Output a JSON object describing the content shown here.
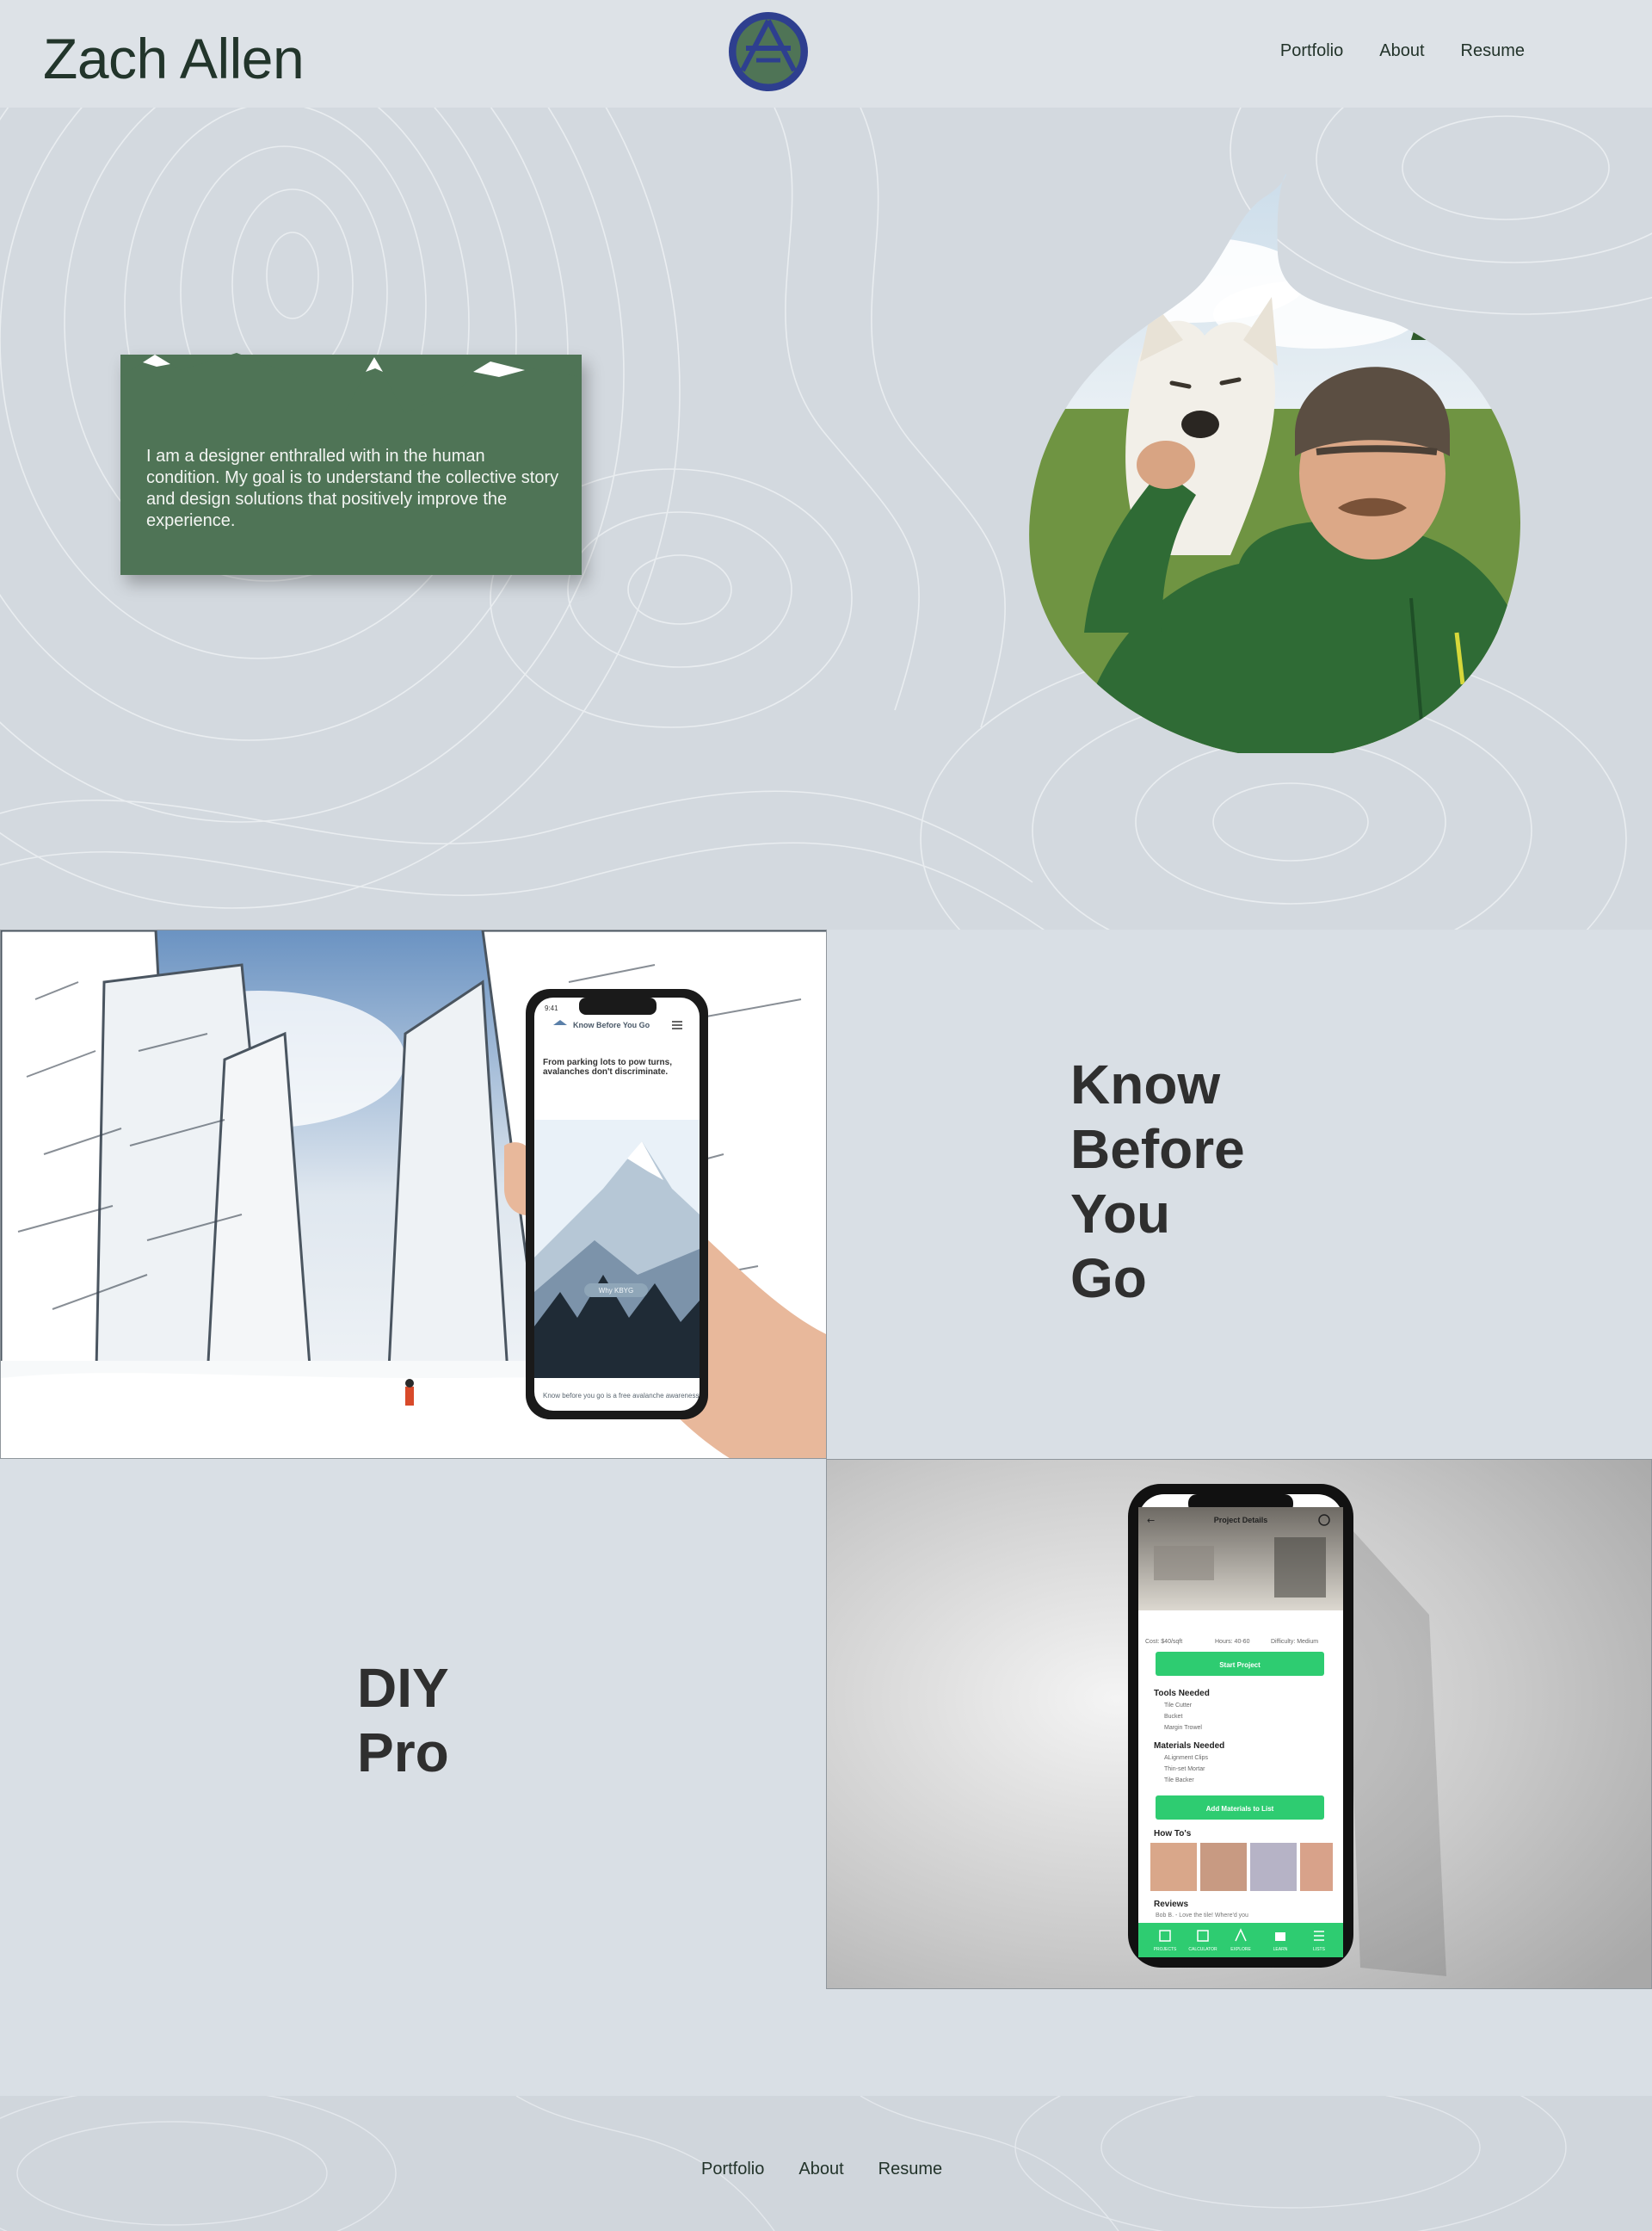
{
  "header": {
    "site_title": "Zach Allen",
    "logo_icon": "mountain-monogram-icon",
    "nav": [
      {
        "label": "Portfolio"
      },
      {
        "label": "About"
      },
      {
        "label": "Resume"
      }
    ]
  },
  "hero": {
    "bio": "I am a designer enthralled with in the human condition. My goal is to understand the collective story and design solutions that positively improve the experience.",
    "portrait_icon": "portrait-photo-with-dog"
  },
  "projects": [
    {
      "title": "Know\nBefore\nYou\nGo",
      "phone": {
        "time": "9:41",
        "app_name": "Know Before You Go",
        "headline": "From parking lots to pow turns, avalanches don't discriminate.",
        "button": "Why KBYG",
        "footer_text": "Know before you go is a free avalanche awareness"
      }
    },
    {
      "title": "DIY\nPro",
      "phone": {
        "screen_title": "Project Details",
        "meta_cost": "Cost: $40/sqft",
        "meta_hours": "Hours: 40-60",
        "meta_difficulty": "Difficulty: Medium",
        "start_button": "Start Project",
        "tools_heading": "Tools Needed",
        "tools": [
          "Tile Cutter",
          "Bucket",
          "Margin Trowel"
        ],
        "materials_heading": "Materials Needed",
        "materials": [
          "ALignment Clips",
          "Thin-set Mortar",
          "Tile Backer"
        ],
        "add_button": "Add Materials to List",
        "howto_heading": "How To's",
        "reviews_heading": "Reviews",
        "review_snippet": "Bob B. - Love the tile! Where'd you",
        "tabs": [
          "PROJECTS",
          "CALCULATOR",
          "EXPLORE",
          "LEARN",
          "LISTS"
        ]
      }
    }
  ],
  "footer": {
    "nav": [
      {
        "label": "Portfolio"
      },
      {
        "label": "About"
      },
      {
        "label": "Resume"
      }
    ]
  },
  "colors": {
    "page_bg": "#d9dfe5",
    "brand_green": "#4f7456",
    "logo_blue": "#2e3f8f",
    "accent_green": "#2ecc71"
  }
}
